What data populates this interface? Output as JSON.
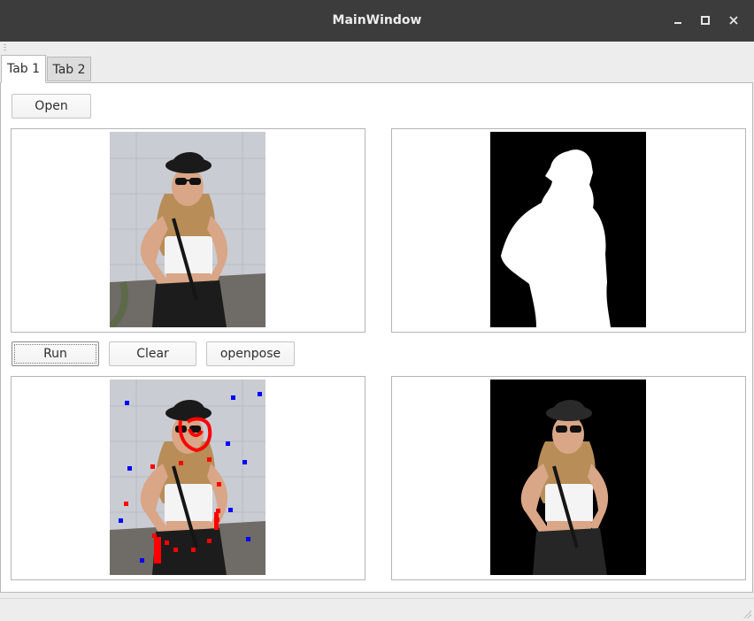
{
  "window": {
    "title": "MainWindow"
  },
  "tabs": [
    {
      "label": "Tab 1",
      "active": true
    },
    {
      "label": "Tab 2",
      "active": false
    }
  ],
  "buttons": {
    "open": "Open",
    "run": "Run",
    "clear": "Clear",
    "openpose": "openpose"
  },
  "views": {
    "original": "Photo of a woman in a black bucket hat, sunglasses and white crop top",
    "mask": "Binary segmentation mask (white silhouette on black)",
    "pose": "Photo with red and blue pose keypoint markers",
    "cutout": "Person cut out on black background"
  },
  "colors": {
    "titlebar": "#3c3c3c",
    "keypoint_red": "#ff0000",
    "keypoint_blue": "#0000ff"
  }
}
